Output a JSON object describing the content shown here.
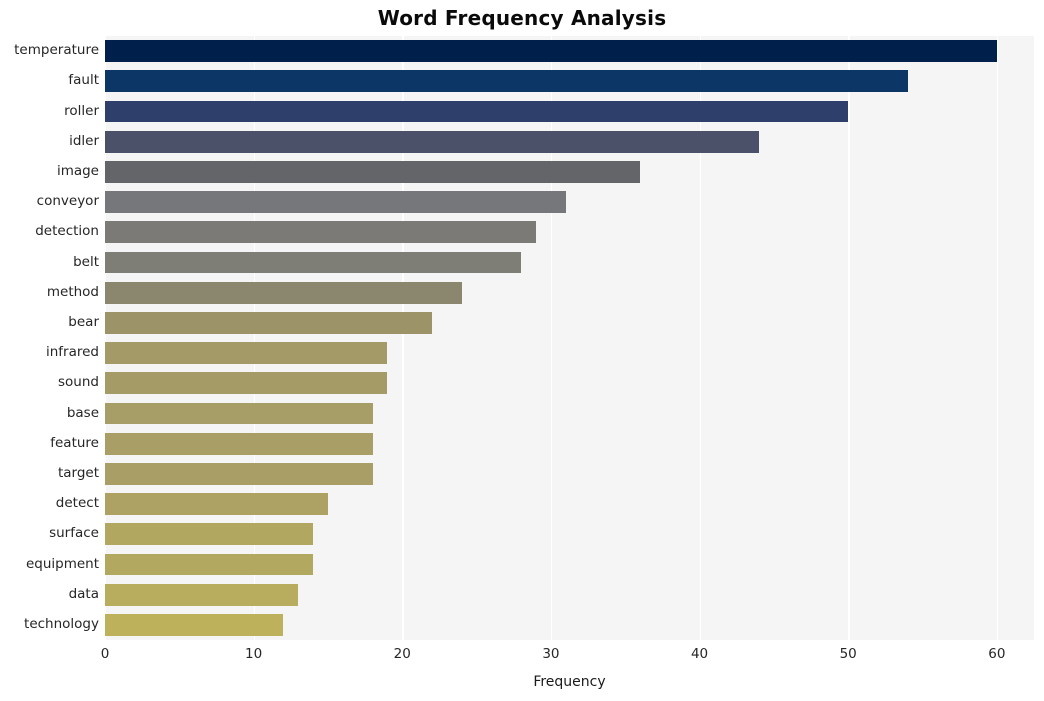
{
  "chart_data": {
    "type": "bar",
    "orientation": "horizontal",
    "title": "Word Frequency Analysis",
    "xlabel": "Frequency",
    "ylabel": "",
    "xlim": [
      0,
      62.5
    ],
    "ylim_categories": 20,
    "xticks": [
      0,
      10,
      20,
      30,
      40,
      50,
      60
    ],
    "xticklabels": [
      "0",
      "10",
      "20",
      "30",
      "40",
      "50",
      "60"
    ],
    "grid": "vertical-white-on-gray",
    "legend": "none",
    "background": "#f5f5f5",
    "categories": [
      "temperature",
      "fault",
      "roller",
      "idler",
      "image",
      "conveyor",
      "detection",
      "belt",
      "method",
      "bear",
      "infrared",
      "sound",
      "base",
      "feature",
      "target",
      "detect",
      "surface",
      "equipment",
      "data",
      "technology"
    ],
    "values": [
      60,
      54,
      50,
      44,
      36,
      31,
      29,
      28,
      24,
      22,
      19,
      19,
      18,
      18,
      18,
      15,
      14,
      14,
      13,
      12
    ],
    "colors": [
      "#00204c",
      "#0b3665",
      "#2e3f6c",
      "#4b5168",
      "#636569",
      "#76777a",
      "#7b7a77",
      "#7f7e76",
      "#8b866e",
      "#9c9468",
      "#a49a67",
      "#a59b67",
      "#a79d66",
      "#a89e66",
      "#a89e66",
      "#ada264",
      "#b2a760",
      "#b3a860",
      "#b8ac5e",
      "#bdb15c"
    ],
    "colormap": "cividis"
  },
  "axis": {
    "title": "Word Frequency Analysis",
    "xlabel": "Frequency"
  }
}
